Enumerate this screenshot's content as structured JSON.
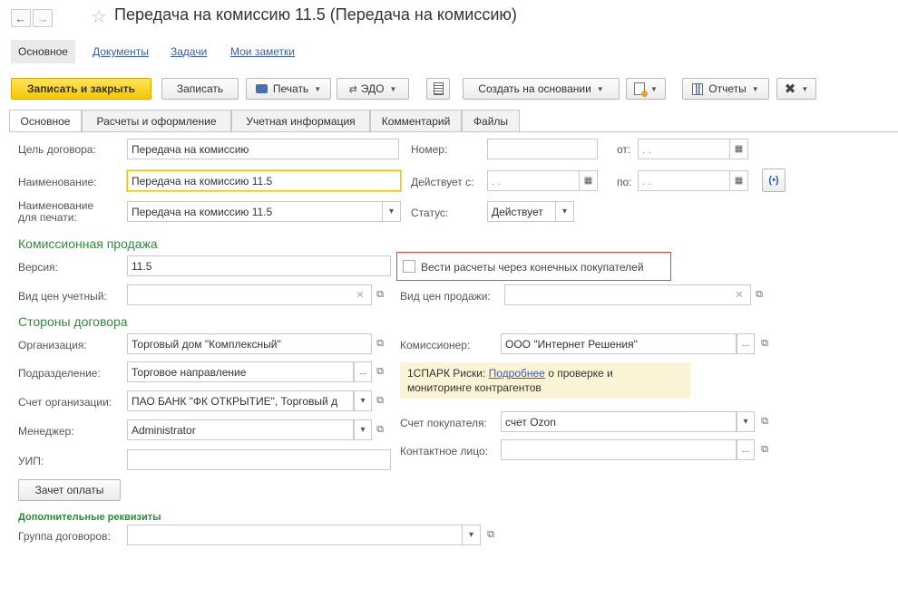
{
  "window": {
    "title": "Передача на комиссию 11.5 (Передача на комиссию)",
    "back_glyph": "←",
    "forward_glyph": "→",
    "star_glyph": "☆"
  },
  "section_tabs": [
    "Основное",
    "Документы",
    "Задачи",
    "Мои заметки"
  ],
  "toolbar": {
    "save_close": "Записать и закрыть",
    "save": "Записать",
    "print": "Печать",
    "edo": "ЭДО",
    "create_based": "Создать на основании",
    "reports": "Отчеты"
  },
  "tabs": [
    "Основное",
    "Расчеты и оформление",
    "Учетная информация",
    "Комментарий",
    "Файлы"
  ],
  "form": {
    "purpose_label": "Цель договора:",
    "purpose_value": "Передача на комиссию",
    "number_label": "Номер:",
    "number_value": "",
    "from_label": "от:",
    "from_value": " .  .",
    "name_label": "Наименование:",
    "name_value": "Передача на комиссию 11.5",
    "valid_from_label": "Действует с:",
    "valid_from_value": " .  .",
    "to_label": "по:",
    "to_value": " .  .",
    "print_name_label_1": "Наименование",
    "print_name_label_2": "для печати:",
    "print_name_value": "Передача на комиссию 11.5",
    "status_label": "Статус:",
    "status_value": "Действует"
  },
  "commission": {
    "section_title": "Комиссионная продажа",
    "version_label": "Версия:",
    "version_value": "11.5",
    "end_buyers_label": "Вести расчеты через конечных покупателей",
    "end_buyers_checked": false,
    "price_type_label": "Вид цен учетный:",
    "price_type_value": "",
    "sale_price_label": "Вид цен продажи:",
    "sale_price_value": ""
  },
  "parties": {
    "section_title": "Стороны договора",
    "org_label": "Организация:",
    "org_value": "Торговый дом \"Комплексный\"",
    "commissioner_label": "Комиссионер:",
    "commissioner_value": "ООО \"Интернет Решения\"",
    "division_label": "Подразделение:",
    "division_value": "Торговое направление",
    "spark_prefix": "1СПАРК Риски: ",
    "spark_link": "Подробнее",
    "spark_suffix": " о проверке и",
    "spark_line2": "мониторинге контрагентов",
    "org_account_label": "Счет организации:",
    "org_account_value": "ПАО БАНК \"ФК ОТКРЫТИЕ\", Торговый д",
    "buyer_account_label": "Счет покупателя:",
    "buyer_account_value": "счет Ozon",
    "manager_label": "Менеджер:",
    "manager_value": "Administrator",
    "contact_label": "Контактное лицо:",
    "contact_value": "",
    "uip_label": "УИП:",
    "uip_value": "",
    "offset_button": "Зачет оплаты"
  },
  "additional": {
    "section_title": "Дополнительные реквизиты",
    "group_label": "Группа договоров:",
    "group_value": ""
  },
  "colors": {
    "primary_button": "#f5c800",
    "section_title": "#2e8b3c",
    "highlight_box": "#e0454a",
    "link": "#3a5ea6"
  }
}
